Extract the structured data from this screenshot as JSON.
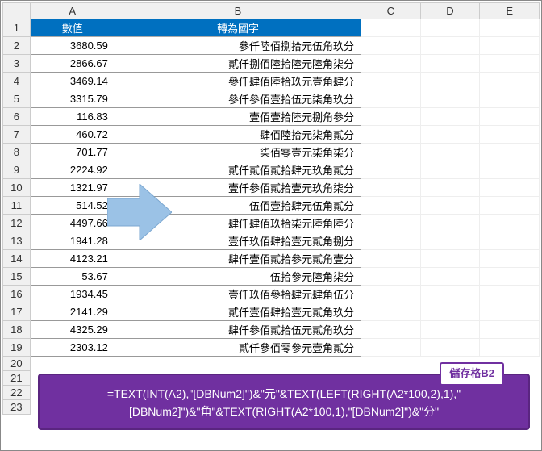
{
  "columns": [
    "A",
    "B",
    "C",
    "D",
    "E"
  ],
  "headers": {
    "a": "數值",
    "b": "轉為國字"
  },
  "rows": [
    {
      "num": "3680.59",
      "txt": "參仟陸佰捌拾元伍角玖分"
    },
    {
      "num": "2866.67",
      "txt": "貳仟捌佰陸拾陸元陸角柒分"
    },
    {
      "num": "3469.14",
      "txt": "參仟肆佰陸拾玖元壹角肆分"
    },
    {
      "num": "3315.79",
      "txt": "參仟參佰壹拾伍元柒角玖分"
    },
    {
      "num": "116.83",
      "txt": "壹佰壹拾陸元捌角參分"
    },
    {
      "num": "460.72",
      "txt": "肆佰陸拾元柒角貳分"
    },
    {
      "num": "701.77",
      "txt": "柒佰零壹元柒角柒分"
    },
    {
      "num": "2224.92",
      "txt": "貳仟貳佰貳拾肆元玖角貳分"
    },
    {
      "num": "1321.97",
      "txt": "壹仟參佰貳拾壹元玖角柒分"
    },
    {
      "num": "514.52",
      "txt": "伍佰壹拾肆元伍角貳分"
    },
    {
      "num": "4497.66",
      "txt": "肆仟肆佰玖拾柒元陸角陸分"
    },
    {
      "num": "1941.28",
      "txt": "壹仟玖佰肆拾壹元貳角捌分"
    },
    {
      "num": "4123.21",
      "txt": "肆仟壹佰貳拾參元貳角壹分"
    },
    {
      "num": "53.67",
      "txt": "伍拾參元陸角柒分"
    },
    {
      "num": "1934.45",
      "txt": "壹仟玖佰參拾肆元肆角伍分"
    },
    {
      "num": "2141.29",
      "txt": "貳仟壹佰肆拾壹元貳角玖分"
    },
    {
      "num": "4325.29",
      "txt": "肆仟參佰貳拾伍元貳角玖分"
    },
    {
      "num": "2303.12",
      "txt": "貳仟參佰零參元壹角貳分"
    }
  ],
  "formula": {
    "tag": "儲存格B2",
    "text": "=TEXT(INT(A2),\"[DBNum2]\")&\"元\"&TEXT(LEFT(RIGHT(A2*100,2),1),\"[DBNum2]\")&\"角\"&TEXT(RIGHT(A2*100,1),\"[DBNum2]\")&\"分\""
  },
  "row_count_shown": 23
}
